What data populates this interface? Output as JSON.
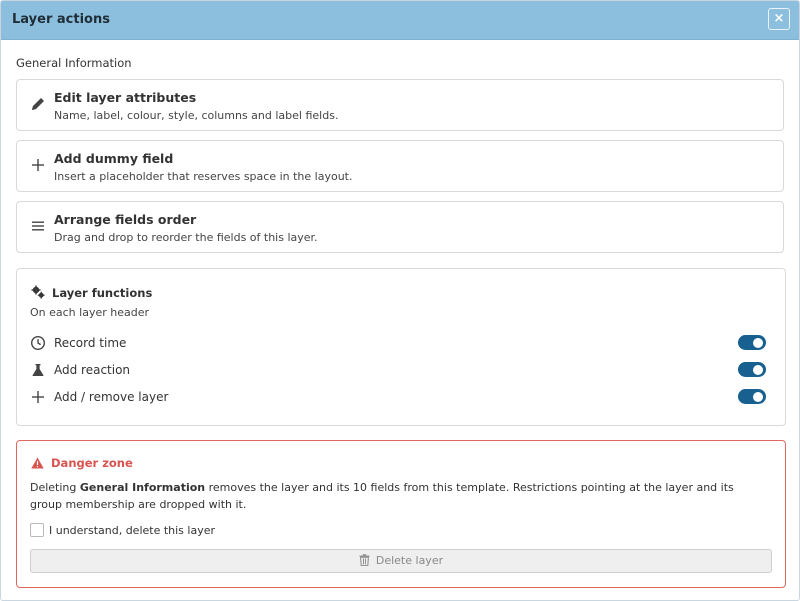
{
  "header": {
    "title": "Layer actions",
    "close_symbol": "×"
  },
  "section_title": "General Information",
  "actions": [
    {
      "icon": "pencil-icon",
      "title": "Edit layer attributes",
      "description": "Name, label, colour, style, columns and label fields."
    },
    {
      "icon": "plus-icon",
      "title": "Add dummy field",
      "description": "Insert a placeholder that reserves space in the layout."
    },
    {
      "icon": "bars-icon",
      "title": "Arrange fields order",
      "description": "Drag and drop to reorder the fields of this layer."
    }
  ],
  "layer_functions": {
    "title": "Layer functions",
    "subtitle": "On each layer header",
    "items": [
      {
        "icon": "clock-icon",
        "label": "Record time",
        "enabled": true
      },
      {
        "icon": "flask-icon",
        "label": "Add reaction",
        "enabled": true
      },
      {
        "icon": "plus-icon",
        "label": "Add / remove layer",
        "enabled": true
      }
    ]
  },
  "danger_zone": {
    "title": "Danger zone",
    "text_before": "Deleting ",
    "layer_name": "General Information",
    "text_after": " removes the layer and its 10 fields from this template. Restrictions pointing at the layer and its group membership are dropped with it.",
    "checkbox_label": "I understand, delete this layer",
    "delete_label": "Delete layer"
  },
  "colors": {
    "header_bg": "#8cbfde",
    "toggle_on": "#17608f",
    "danger": "#d9534f"
  }
}
